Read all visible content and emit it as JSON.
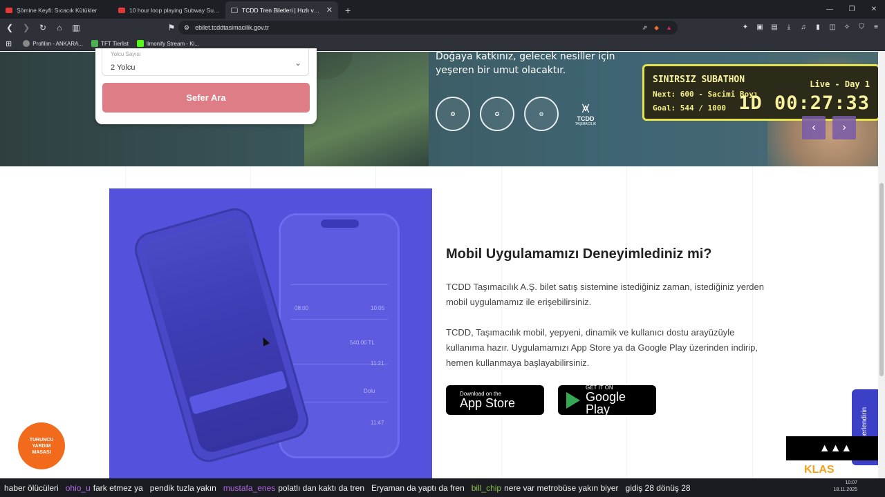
{
  "browser": {
    "tabs": [
      {
        "title": "Şömine Keyfi: Sıcacık Kütükler"
      },
      {
        "title": "10 hour loop playing Subway Surfers"
      },
      {
        "title": "TCDD Tren Biletleri | Hızlı ve Güv"
      }
    ],
    "url": "ebilet.tcddtasimacilik.gov.tr",
    "bookmarks": [
      "Profilim - ANKARA...",
      "TFT Tierlist",
      "limonify Stream - Ki..."
    ]
  },
  "search_card": {
    "passenger_label": "Yolcu Sayısı",
    "passenger_value": "2 Yolcu",
    "search_button": "Sefer Ara"
  },
  "hero": {
    "text": "Doğaya katkınız, gelecek nesiller için yeşeren bir umut olacaktır.",
    "logo_title": "TCDD",
    "logo_subtitle": "TAŞIMACILIK"
  },
  "subathon": {
    "title": "SINIRSIZ SUBATHON",
    "next": "Next: 600 - Sacimi Boyı",
    "goal": "Goal: 544 / 1000",
    "live": "Live - Day 1",
    "timer": "1D 00:27:33"
  },
  "mobile_section": {
    "title": "Mobil Uygulamamızı Deneyimlediniz mi?",
    "para1": "TCDD Taşımacılık A.Ş. bilet satış sistemine istediğiniz zaman, istediğiniz yerden mobil uygulamamız ile erişebilirsiniz.",
    "para2": "TCDD, Taşımacılık mobil, yepyeni, dinamik ve kullanıcı dostu arayüzüyle kullanıma hazır. Uygulamamızı App Store ya da Google Play üzerinden indirip, hemen kullanmaya başlayabilirsiniz.",
    "appstore_small": "Download on the",
    "appstore_big": "App Store",
    "gplay_small": "GET IT ON",
    "gplay_big": "Google Play"
  },
  "phone_mock": {
    "time1": "08:00",
    "time2": "10:05",
    "price": "540.00 TL",
    "status": "Dolu",
    "time3": "11:21",
    "time4": "11:47"
  },
  "feedback_label": "Değerlendirin",
  "help_badge": [
    "TURUNCU",
    "YARDIM",
    "MASASI"
  ],
  "overlay": {
    "brand": "KLAS"
  },
  "ticker": [
    {
      "user": "",
      "msg": "haber ölücüleri"
    },
    {
      "user": "ohio_u",
      "msg": "fark etmez ya"
    },
    {
      "user": "",
      "msg": "pendik tuzla yakın"
    },
    {
      "user": "mustafa_enes",
      "msg": "polatlı dan kaktı da tren"
    },
    {
      "user": "",
      "msg": "Eryaman da yaptı da fren"
    },
    {
      "user": "bill_chip",
      "msg": "nere var metrobüse yakın biyer"
    },
    {
      "user": "",
      "msg": "gidiş 28 dönüş 28"
    }
  ],
  "clock": {
    "time": "10:07",
    "date": "18.11.2025"
  },
  "colors": {
    "search_button": "#df7d86",
    "phone_bg": "#5451dc",
    "subathon_border": "#e9e34b",
    "feedback": "#3c40c6",
    "help_badge": "#f26a1b"
  }
}
